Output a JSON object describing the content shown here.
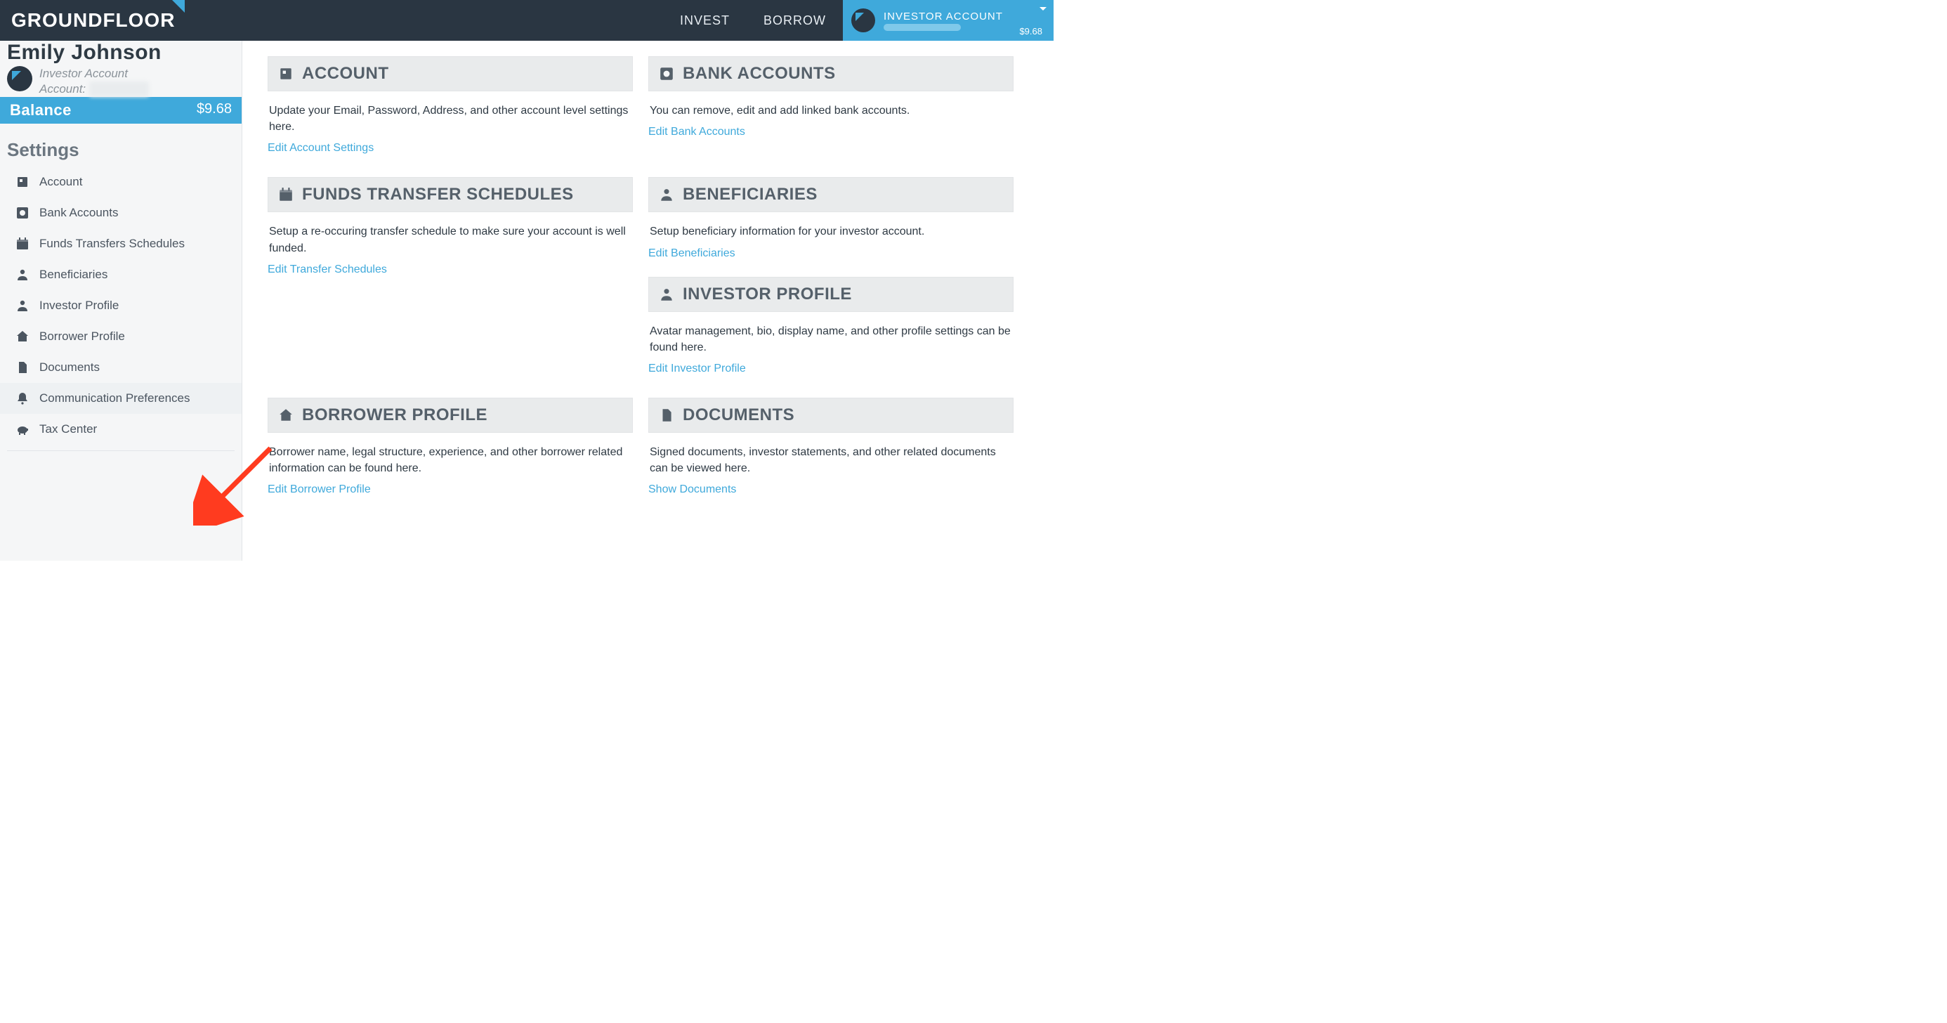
{
  "brand": "GROUNDFLOOR",
  "nav": {
    "invest": "INVEST",
    "borrow": "BORROW"
  },
  "account_pill": {
    "title": "INVESTOR ACCOUNT",
    "balance": "$9.68"
  },
  "profile": {
    "name": "Emily Johnson",
    "type": "Investor Account",
    "account_label": "Account:"
  },
  "balance": {
    "label": "Balance",
    "amount": "$9.68"
  },
  "sidebar": {
    "section": "Settings",
    "items": [
      {
        "label": "Account",
        "icon": "account"
      },
      {
        "label": "Bank Accounts",
        "icon": "bank"
      },
      {
        "label": "Funds Transfers Schedules",
        "icon": "calendar"
      },
      {
        "label": "Beneficiaries",
        "icon": "person"
      },
      {
        "label": "Investor Profile",
        "icon": "person"
      },
      {
        "label": "Borrower Profile",
        "icon": "home"
      },
      {
        "label": "Documents",
        "icon": "doc"
      },
      {
        "label": "Communication Preferences",
        "icon": "bell"
      },
      {
        "label": "Tax Center",
        "icon": "piggy"
      }
    ]
  },
  "cards": {
    "account": {
      "title": "ACCOUNT",
      "desc": "Update your Email, Password, Address, and other account level settings here.",
      "link": "Edit Account Settings"
    },
    "bank": {
      "title": "BANK ACCOUNTS",
      "desc": "You can remove, edit and add linked bank accounts.",
      "link": "Edit Bank Accounts"
    },
    "funds": {
      "title": "FUNDS TRANSFER SCHEDULES",
      "desc": "Setup a re-occuring transfer schedule to make sure your account is well funded.",
      "link": "Edit Transfer Schedules"
    },
    "beneficiaries": {
      "title": "BENEFICIARIES",
      "desc": "Setup beneficiary information for your investor account.",
      "link": "Edit Beneficiaries"
    },
    "investor": {
      "title": "INVESTOR PROFILE",
      "desc": "Avatar management, bio, display name, and other profile settings can be found here.",
      "link": "Edit Investor Profile"
    },
    "borrower": {
      "title": "BORROWER PROFILE",
      "desc": "Borrower name, legal structure, experience, and other borrower related information can be found here.",
      "link": "Edit Borrower Profile"
    },
    "documents": {
      "title": "DOCUMENTS",
      "desc": "Signed documents, investor statements, and other related documents can be viewed here.",
      "link": "Show Documents"
    }
  }
}
